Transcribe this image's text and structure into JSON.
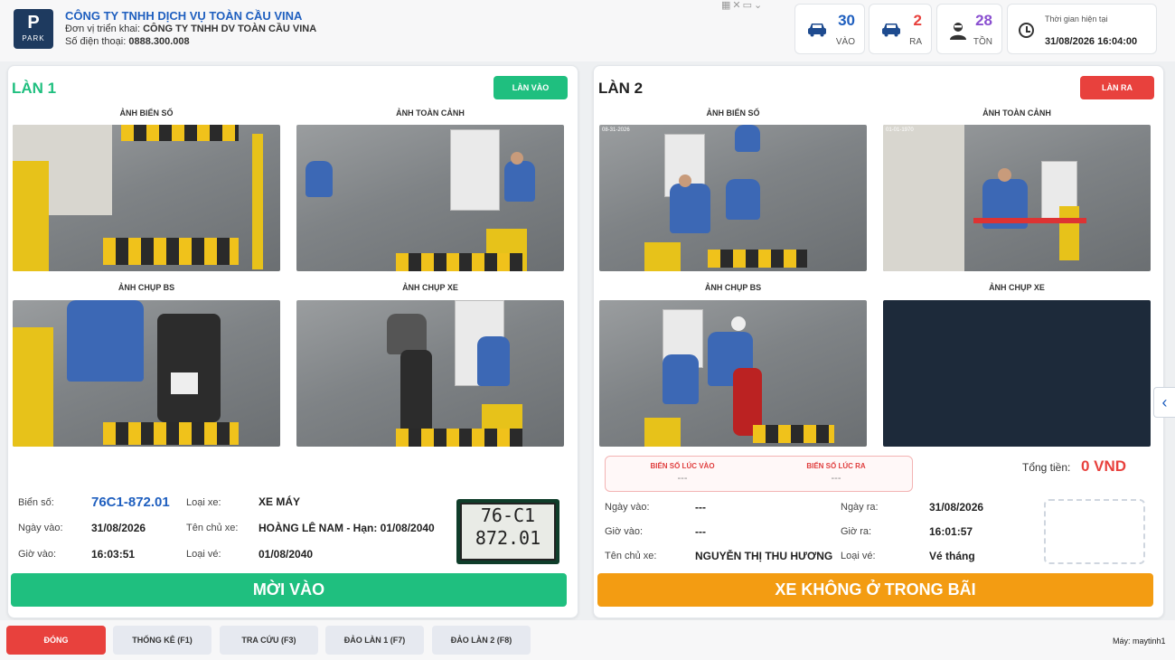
{
  "header": {
    "logo_letter": "P",
    "logo_text": "PARK",
    "company_name": "CÔNG TY TNHH DỊCH VỤ TOÀN CẦU VINA",
    "deploy_label": "Đơn vị triển khai:",
    "deploy_value": "CÔNG TY TNHH DV TOÀN CẦU VINA",
    "phone_label": "Số điện thoại:",
    "phone_value": "0888.300.008"
  },
  "stats": {
    "in": {
      "value": "30",
      "label": "VÀO",
      "color": "#1f5fbf"
    },
    "out": {
      "value": "2",
      "label": "RA",
      "color": "#e8413d"
    },
    "remain": {
      "value": "28",
      "label": "TỒN",
      "color": "#8a4fd0"
    }
  },
  "time": {
    "label": "Thời gian hiện tại",
    "value": "31/08/2026 16:04:00"
  },
  "lane1": {
    "title": "LÀN 1",
    "badge": "LÀN VÀO",
    "captions": {
      "plate": "ẢNH BIỂN SỐ",
      "overview": "ẢNH TOÀN CẢNH",
      "plate_shot": "ẢNH CHỤP BS",
      "vehicle_shot": "ẢNH CHỤP XE"
    },
    "info": {
      "plate_label": "Biển số:",
      "plate_value": "76C1-872.01",
      "type_label": "Loại xe:",
      "type_value": "XE MÁY",
      "in_date_label": "Ngày vào:",
      "in_date_value": "31/08/2026",
      "owner_label": "Tên chủ xe:",
      "owner_value": "HOÀNG LÊ NAM - Hạn: 01/08/2040",
      "in_time_label": "Giờ vào:",
      "in_time_value": "16:03:51",
      "ticket_label": "Loại vé:",
      "ticket_value": "01/08/2040"
    },
    "plate_image_line1": "76-C1",
    "plate_image_line2": "872.01",
    "action": "MỜI VÀO",
    "action_color": "#1fbf7f"
  },
  "lane2": {
    "title": "LÀN 2",
    "badge": "LÀN RA",
    "captions": {
      "plate": "ẢNH BIỂN SỐ",
      "overview": "ẢNH TOÀN CẢNH",
      "plate_shot": "ẢNH CHỤP BS",
      "vehicle_shot": "ẢNH CHỤP XE"
    },
    "plate_in_label": "BIỂN SỐ LÚC VÀO",
    "plate_in_value": "---",
    "plate_out_label": "BIỂN SỐ LÚC RA",
    "plate_out_value": "---",
    "total_label": "Tổng tiền:",
    "total_value": "0 VND",
    "info": {
      "in_date_label": "Ngày vào:",
      "in_date_value": "---",
      "out_date_label": "Ngày ra:",
      "out_date_value": "31/08/2026",
      "in_time_label": "Giờ vào:",
      "in_time_value": "---",
      "out_time_label": "Giờ ra:",
      "out_time_value": "16:01:57",
      "owner_label": "Tên chủ xe:",
      "owner_value": "NGUYỄN THỊ THU HƯƠNG",
      "ticket_label": "Loại vé:",
      "ticket_value": "Vé tháng"
    },
    "action": "XE KHÔNG Ở TRONG BÃI",
    "action_color": "#f39c12"
  },
  "bottom": {
    "buttons": [
      "ĐÓNG",
      "THỐNG KÊ (F1)",
      "TRA CỨU (F3)",
      "ĐẢO LÀN 1 (F7)",
      "ĐẢO LÀN 2 (F8)"
    ],
    "machine": "Máy: maytinh1"
  }
}
